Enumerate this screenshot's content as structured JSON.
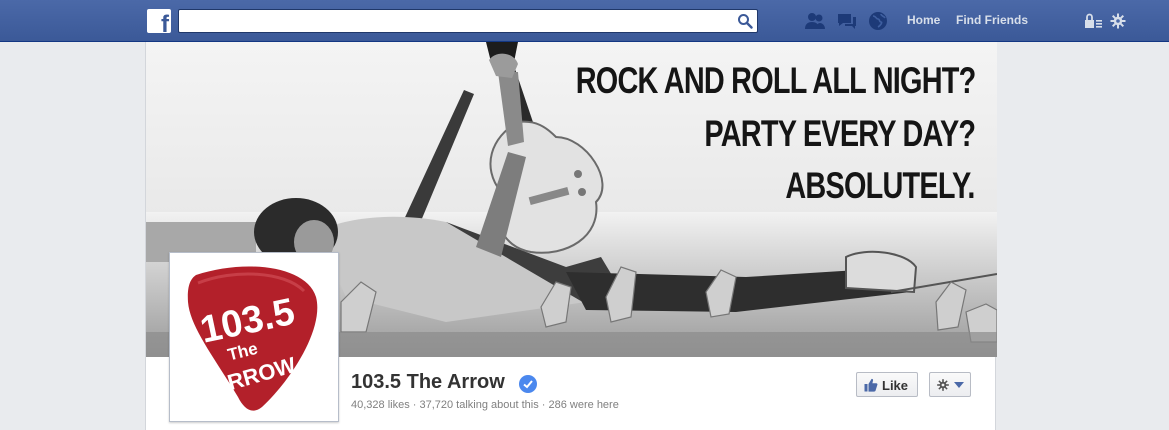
{
  "topbar": {
    "logo": "f",
    "search_placeholder": "",
    "nav_links": {
      "home": "Home",
      "find_friends": "Find Friends"
    },
    "icons": [
      "friend-requests-icon",
      "messages-icon",
      "notifications-globe-icon",
      "privacy-lock-icon",
      "settings-gear-icon"
    ],
    "brand_color": "#3b5998"
  },
  "cover": {
    "headline": [
      "ROCK AND ROLL ALL NIGHT?",
      "PARTY EVERY DAY?",
      "ABSOLUTELY."
    ]
  },
  "profile": {
    "logo_text": {
      "number": "103.5",
      "the": "The",
      "arrow": "ARROW"
    },
    "logo_color": "#b3202a"
  },
  "page": {
    "name": "103.5 The Arrow",
    "stats": "40,328 likes · 37,720 talking about this · 286 were here"
  },
  "actions": {
    "like_label": "Like"
  }
}
